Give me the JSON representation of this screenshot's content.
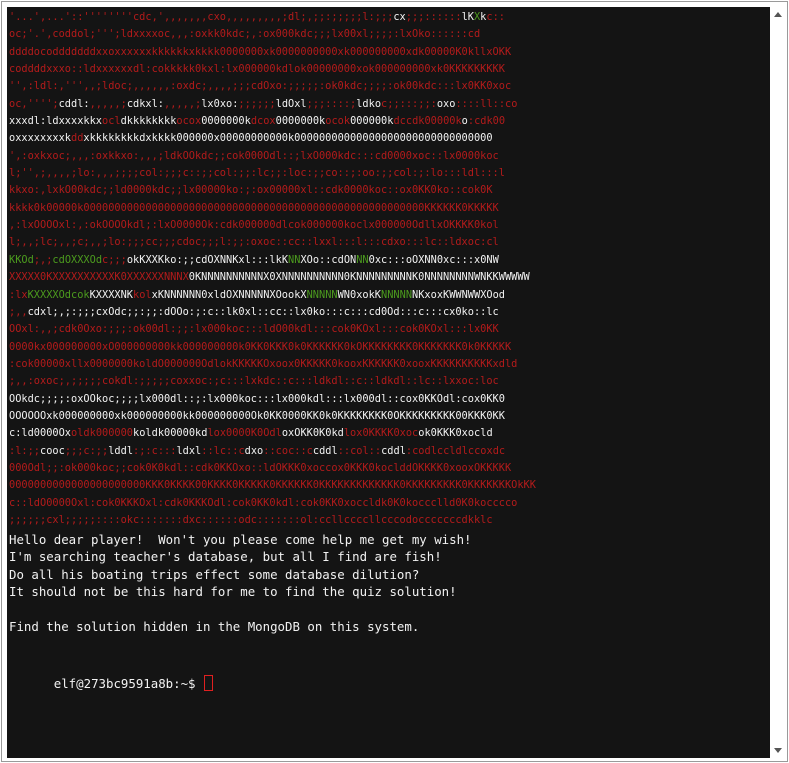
{
  "terminal": {
    "art_lines": [
      [
        [
          "r",
          "'...',...'::''''''''cdc,',,,,,,,cxo,,,,,,,,,;dl;,;;:;;;;;l:;;;"
        ],
        [
          "w",
          "cx"
        ],
        [
          "r",
          ";;;::::::"
        ],
        [
          "w",
          "lK"
        ],
        [
          "g",
          "X"
        ],
        [
          "w",
          "k"
        ],
        [
          "r",
          "c::"
        ]
      ],
      [
        [
          "r",
          "oc;'.',coddol;''';ldxxxxoc,,,:oxkk0kdc;,:ox000kdc;;;lx00xl;;;;:lxOko::::::cd"
        ]
      ],
      [
        [
          "r",
          "ddddocodddddddxxoxxxxxxkkkkkkxkkkk0000000xk0000000000xk000000000xdk00000K0kllxOKK"
        ]
      ],
      [
        [
          "r",
          "coddddxxxo::ldxxxxxxdl:cokkkkk0kxl:lx000000kdlok00000000xok000000000xk0KKKKKKKKK"
        ]
      ],
      [
        [
          "r",
          "'',:ldl:,''',,;ldoc;,,,,,,:oxdc;,,,,;;;cdOxo:;;;;;:ok0kdc;;;;:ok00kdc:::lx0KK0xoc"
        ]
      ],
      [
        [
          "r",
          "oc,'''';"
        ],
        [
          "w",
          "cddl:"
        ],
        [
          "r",
          ",,,,,;"
        ],
        [
          "w",
          "cdkxl:"
        ],
        [
          "r",
          ",,,,,;"
        ],
        [
          "w",
          "lx0xo:"
        ],
        [
          "r",
          ";;;;;;"
        ],
        [
          "w",
          "ldOxl"
        ],
        [
          "r",
          ";;;::::;"
        ],
        [
          "w",
          "ldko"
        ],
        [
          "r",
          "c;;:::;;:"
        ],
        [
          "w",
          "oxo"
        ],
        [
          "r",
          "::::ll::co"
        ]
      ],
      [
        [
          "w",
          "xxxdl:ldxxxxkkx"
        ],
        [
          "r",
          "ocl"
        ],
        [
          "w",
          "dkkkkkkkk"
        ],
        [
          "r",
          "ocox"
        ],
        [
          "w",
          "0000000k"
        ],
        [
          "r",
          "dcox"
        ],
        [
          "w",
          "0000000k"
        ],
        [
          "r",
          "ocok"
        ],
        [
          "w",
          "000000k"
        ],
        [
          "r",
          "dccdk00000k"
        ],
        [
          "w",
          "o"
        ],
        [
          "r",
          ":cdk00"
        ]
      ],
      [
        [
          "w",
          "oxxxxxxxxk"
        ],
        [
          "r",
          "dd"
        ],
        [
          "w",
          "xkkkkkkkkdxkkkk000000x00000000000k00000000000000000000000000000000"
        ]
      ],
      [
        [
          "r",
          "',:oxkxoc;,,,:oxkkxo:,,,;ldkOOkdc;;cok000Odl::;lxO000kdc:::cd0000xoc::lx0000koc"
        ]
      ],
      [
        [
          "r",
          "l;'',;,,,,;lo:,,,;;;;col:;;;c::;;col:;;:lc;;:loc:;;co::;:oo:;;col:;:lo:::ldl:::l"
        ]
      ],
      [
        [
          "r",
          "kkxo:,lxkO00kdc;;ld0000kdc;;lx00000ko:;:ox00000xl::cdk0000koc::ox0KK0ko::cok0K"
        ]
      ],
      [
        [
          "r",
          "kkkk0k00000k0000000000000000000000000000000000000000000000000000000KKKKKK0KKKKK"
        ]
      ],
      [
        [
          "r",
          ",:lxOOOOxl:,:okOOOOkdl;:lxO0000Ok:cdk000000dlcok000000koclx000000OdllxOKKKK0kol"
        ]
      ],
      [
        [
          "r",
          "l;,,;lc;,,;c;,,;lo:;;;cc;;;cdoc;;;l:;;:oxoc::cc::lxxl:::l:::cdxo:::lc::ldxoc:cl"
        ]
      ],
      [
        [
          "g",
          "KKOd"
        ],
        [
          "r",
          ";,;"
        ],
        [
          "g",
          "cdOXXXOd"
        ],
        [
          "r",
          "c;;;"
        ],
        [
          "w",
          "okKXXKko:;;cdOXNNKxl:::lkK"
        ],
        [
          "g",
          "NN"
        ],
        [
          "w",
          "XOo::cdON"
        ],
        [
          "g",
          "NN"
        ],
        [
          "w",
          "0xc:::oOXNN0xc:::x0NW"
        ]
      ],
      [
        [
          "r",
          "XXXXX0KXXXXXXXXXXK0XXXXXXNNNX"
        ],
        [
          "w",
          "0KNNNNNNNNNNX0XNNNNNNNNNN0KNNNNNNNNNK0NNNNNNNNWNKKWWWWW"
        ]
      ],
      [
        [
          "r",
          ":lx"
        ],
        [
          "g",
          "KXXXXOdcok"
        ],
        [
          "w",
          "KXXXXNK"
        ],
        [
          "r",
          "kol"
        ],
        [
          "w",
          "xKNNNNNN0xldOXNNNNNXOookX"
        ],
        [
          "g",
          "NNNNN"
        ],
        [
          "w",
          "WN0xokK"
        ],
        [
          "g",
          "NNNNN"
        ],
        [
          "w",
          "NKxoxKWWNWWXOod"
        ]
      ],
      [
        [
          "r",
          ";,,"
        ],
        [
          "w",
          "cdxl;,;:;;;cxOdc;;:;;:dOOo:;:c::lk0xl::cc::lx0ko:::c:::cd0Od:::c:::cx0ko::lc"
        ]
      ],
      [
        [
          "r",
          "OOxl:,,;cdk0Oxo:;;;:ok00dl:;;:lx000koc:::ldO00kdl:::cok0KOxl:::cok0KOxl:::lx0KK"
        ]
      ],
      [
        [
          "r",
          "0000kx000000000xO000000000kk000000000k0KK0KKK0k0KKKKKK0kOKKKKKKKK0KKKKKKK0k0KKKKK"
        ]
      ],
      [
        [
          "r",
          ":cok00000xllx0000000koldO000000OdlokKKKKKOxoox0KKKKK0kooxKKKKKK0xooxKKKKKKKKKKxdld"
        ]
      ],
      [
        [
          "r",
          ";,,:oxoc;,;;;;;cokdl:;;;;;coxxoc:;c:::lxkdc::c:::ldkdl::c::ldkdl::lc::lxxoc:loc"
        ]
      ],
      [
        [
          "w",
          "OOkdc;;;;:oxOOkoc;;;;lx000dl::;:lx000koc:::lx000kdl:::lx000dl::cox0KKOdl:co"
        ],
        [
          "w",
          "x0KK0"
        ]
      ],
      [
        [
          "w",
          "OOOOOOxk000000000xk000000000kk000000000Ok0KK0000KK0k0KKKKKKKK0OKKKKKKKKK00KKK0KK"
        ]
      ],
      [
        [
          "w",
          "c:"
        ],
        [
          "w",
          "ld0000Ox"
        ],
        [
          "r",
          "oldk000000"
        ],
        [
          "w",
          "kold"
        ],
        [
          "w",
          "k00000kd"
        ],
        [
          "r",
          "lox0000K0Odl"
        ],
        [
          "w",
          "oxOKK0K0kd"
        ],
        [
          "r",
          "lox0KKKK0xoc"
        ],
        [
          "w",
          "ok0KKK0xocld"
        ]
      ],
      [
        [
          "r",
          ":l:;;"
        ],
        [
          "w",
          "cooc"
        ],
        [
          "r",
          ";;;c:;;"
        ],
        [
          "w",
          "lddl"
        ],
        [
          "r",
          ":;:c:::"
        ],
        [
          "w",
          "ldxl"
        ],
        [
          "r",
          "::lc::c"
        ],
        [
          "w",
          "dxo"
        ],
        [
          "r",
          "::coc::c"
        ],
        [
          "w",
          "cddl"
        ],
        [
          "r",
          "::col::"
        ],
        [
          "w",
          "cddl"
        ],
        [
          "r",
          ":codlccldlccoxdc"
        ]
      ],
      [
        [
          "r",
          "000Odl;;:ok000koc;;cok0K0kdl::cdk0KKOxo::ldOKKK0xoccox0KKK0koclddOKKKK0xooxOKKKKK"
        ]
      ],
      [
        [
          "r",
          "0000000000000000000000KKK0KKKK00KKKK0KKKKK0KKKKKK0KKKKKKKKKKKKK0KKKKKKKKK0KKKKKKKOkKK"
        ]
      ],
      [
        [
          "r",
          "c::ldO0000Oxl:cok0KKKOxl:cdk0KKKOdl:cok0KK0kdl:cok0KK0xoccldk0K0koccclld0K0kocccco"
        ]
      ],
      [
        [
          "r",
          ";;;;;;cxl;;;;;::::okc:::::::dxc::::::odc:::::::ol:ccllccccllcccodocccccccdkklc"
        ]
      ]
    ],
    "message_lines": [
      "Hello dear player!  Won't you please come help me get my wish!",
      "I'm searching teacher's database, but all I find are fish!",
      "Do all his boating trips effect some database dilution?",
      "It should not be this hard for me to find the quiz solution!",
      "",
      "Find the solution hidden in the MongoDB on this system."
    ],
    "prompt": "elf@273bc9591a8b:~$ ",
    "colors": {
      "background": "#141414",
      "red_text": "#b31b1b",
      "white_text": "#f2f2f2",
      "green_text": "#4c9b1e",
      "cursor_border": "#e02020"
    }
  }
}
